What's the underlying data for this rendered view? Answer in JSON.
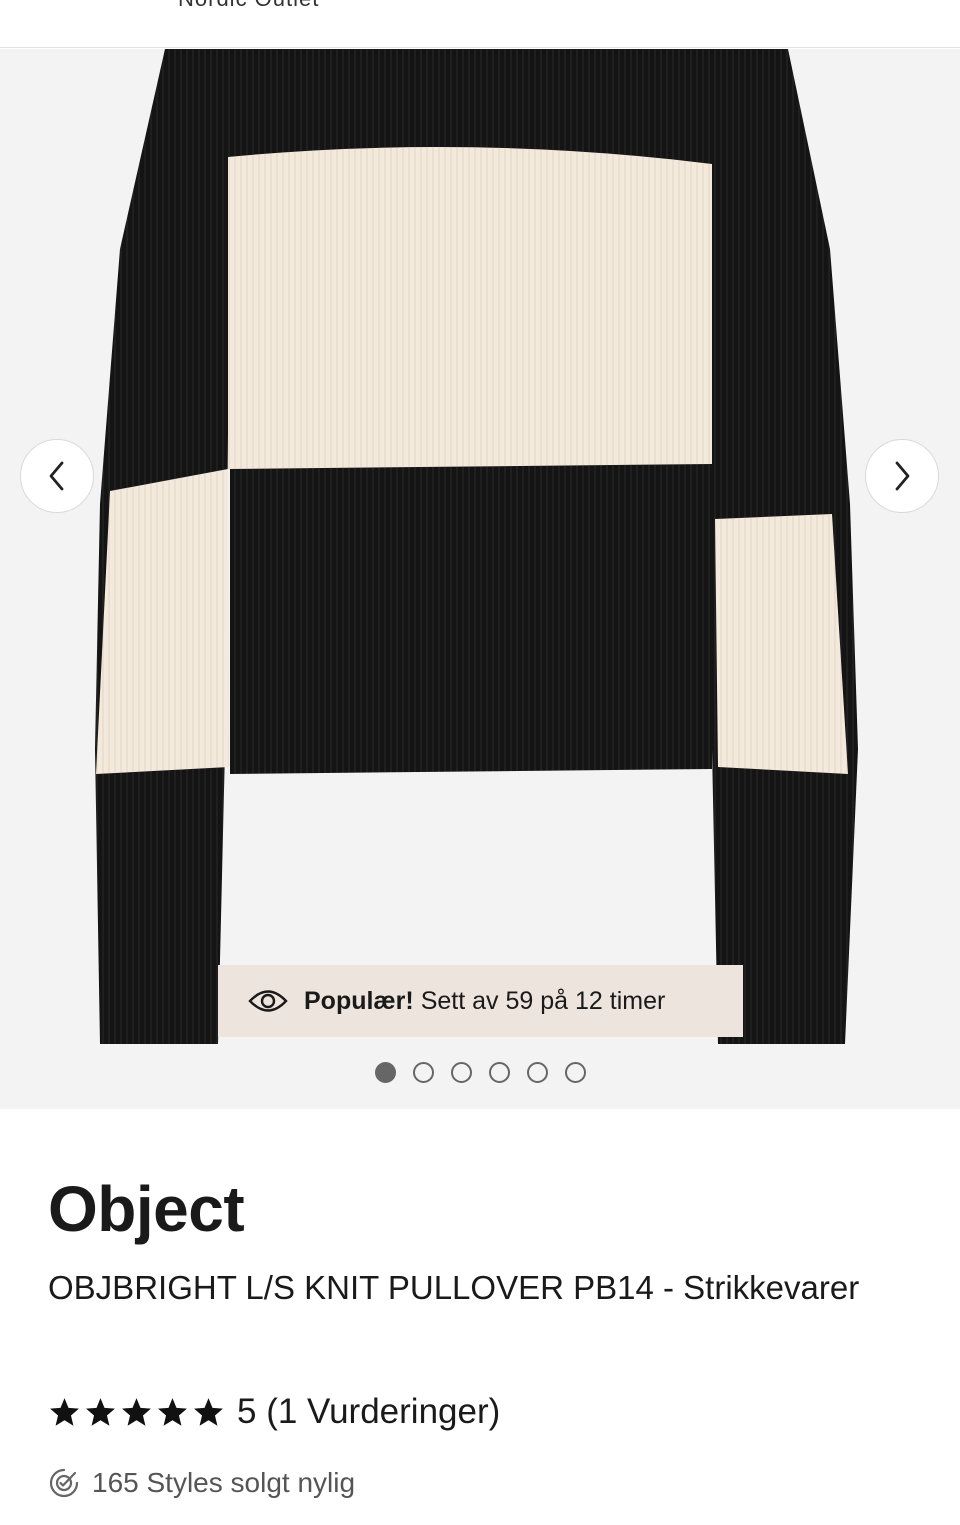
{
  "header": {
    "cut_text": "Nordic Outlet"
  },
  "gallery": {
    "prev_icon": "chevron-left-icon",
    "next_icon": "chevron-right-icon",
    "slide_count": 6,
    "active_slide": 1,
    "colors": {
      "background": "#f3f3f3",
      "knit_black": "#141414",
      "knit_cream": "#f3e9dc"
    }
  },
  "popular": {
    "icon": "eye-icon",
    "label": "Populær!",
    "text": "Sett av 59 på 12 timer"
  },
  "product": {
    "brand": "Object",
    "name": "OBJBRIGHT L/S KNIT PULLOVER PB14 - Strikkevarer",
    "rating_value": 5,
    "stars": 5,
    "rating_text": "5 (1 Vurderinger)",
    "sold_icon": "check-badge-icon",
    "sold_text": "165 Styles solgt nylig"
  }
}
